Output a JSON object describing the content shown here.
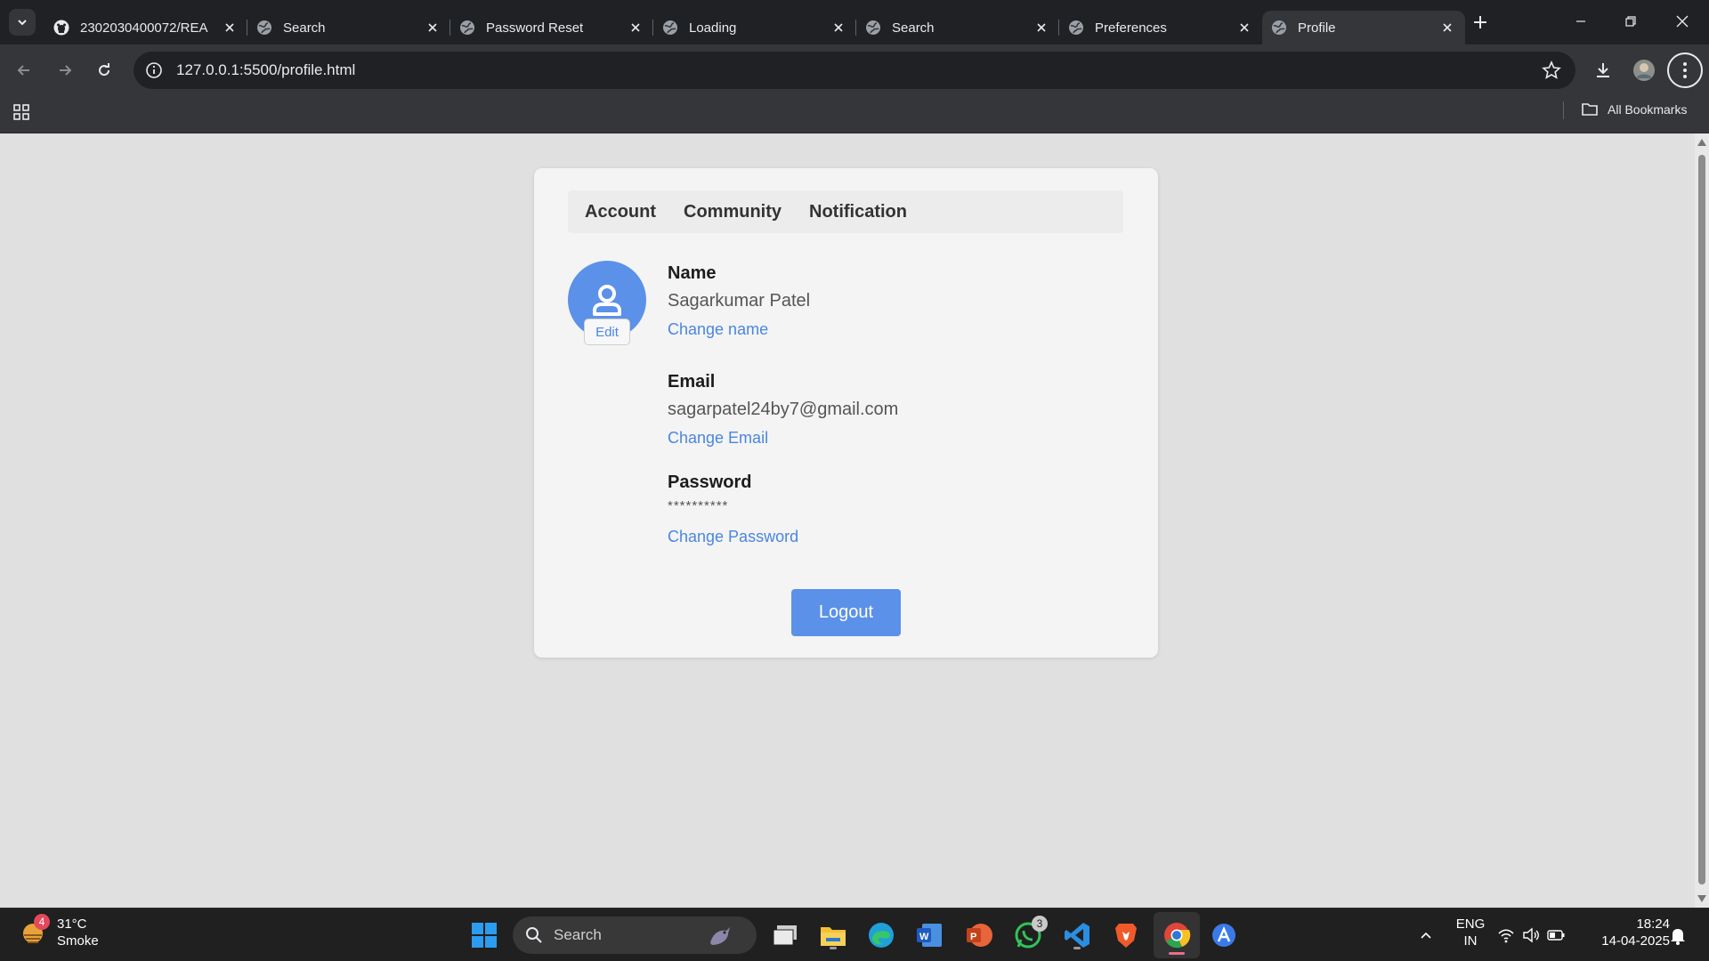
{
  "browser": {
    "tabs": [
      {
        "title": "2302030400072/REA",
        "favicon": "github-icon",
        "active": false
      },
      {
        "title": "Search",
        "favicon": "globe-icon",
        "active": false
      },
      {
        "title": "Password Reset",
        "favicon": "globe-icon",
        "active": false
      },
      {
        "title": "Loading",
        "favicon": "globe-icon",
        "active": false
      },
      {
        "title": "Search",
        "favicon": "globe-icon",
        "active": false
      },
      {
        "title": "Preferences",
        "favicon": "globe-icon",
        "active": false
      },
      {
        "title": "Profile",
        "favicon": "globe-icon",
        "active": true
      }
    ],
    "url": "127.0.0.1:5500/profile.html",
    "bookmarks_label": "All Bookmarks"
  },
  "profile": {
    "tabs": [
      "Account",
      "Community",
      "Notification"
    ],
    "edit_label": "Edit",
    "name": {
      "label": "Name",
      "value": "Sagarkumar Patel",
      "link": "Change name"
    },
    "email": {
      "label": "Email",
      "value": "sagarpatel24by7@gmail.com",
      "link": "Change Email"
    },
    "password": {
      "label": "Password",
      "value": "**********",
      "link": "Change Password"
    },
    "logout_label": "Logout",
    "accent_color": "#5b91e8"
  },
  "taskbar": {
    "weather": {
      "temp": "31°C",
      "condition": "Smoke",
      "badge": "4"
    },
    "search_placeholder": "Search",
    "whatsapp_badge": "3",
    "language": {
      "line1": "ENG",
      "line2": "IN"
    },
    "time": "18:24",
    "date": "14-04-2025"
  }
}
